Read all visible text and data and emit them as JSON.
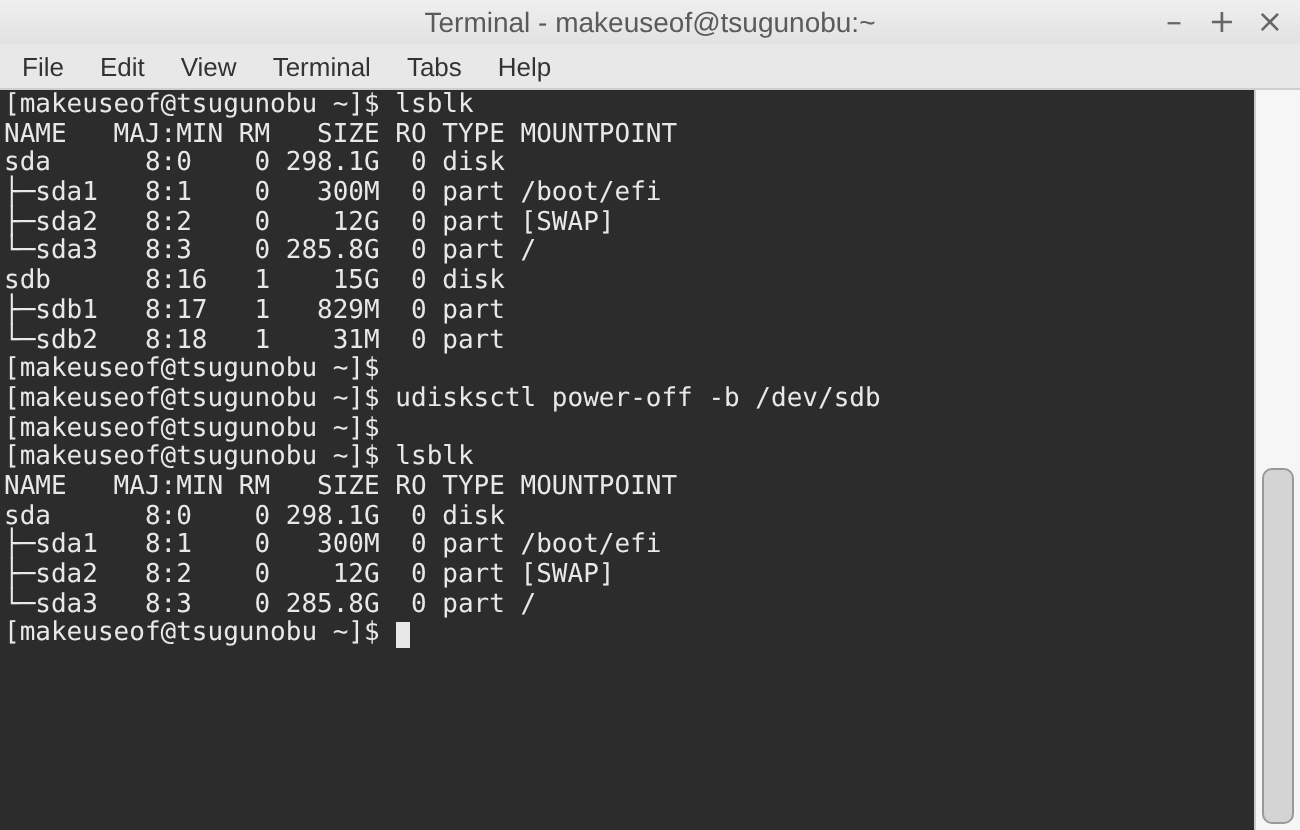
{
  "window": {
    "title": "Terminal - makeuseof@tsugunobu:~",
    "controls": [
      "–",
      "+",
      "×"
    ]
  },
  "menu": [
    "File",
    "Edit",
    "View",
    "Terminal",
    "Tabs",
    "Help"
  ],
  "terminal": {
    "lines": [
      "[makeuseof@tsugunobu ~]$ lsblk",
      "NAME   MAJ:MIN RM   SIZE RO TYPE MOUNTPOINT",
      "sda      8:0    0 298.1G  0 disk",
      "├─sda1   8:1    0   300M  0 part /boot/efi",
      "├─sda2   8:2    0    12G  0 part [SWAP]",
      "└─sda3   8:3    0 285.8G  0 part /",
      "sdb      8:16   1    15G  0 disk",
      "├─sdb1   8:17   1   829M  0 part",
      "└─sdb2   8:18   1    31M  0 part",
      "[makeuseof@tsugunobu ~]$",
      "[makeuseof@tsugunobu ~]$ udisksctl power-off -b /dev/sdb",
      "[makeuseof@tsugunobu ~]$",
      "[makeuseof@tsugunobu ~]$ lsblk",
      "NAME   MAJ:MIN RM   SIZE RO TYPE MOUNTPOINT",
      "sda      8:0    0 298.1G  0 disk",
      "├─sda1   8:1    0   300M  0 part /boot/efi",
      "├─sda2   8:2    0    12G  0 part [SWAP]",
      "└─sda3   8:3    0 285.8G  0 part /",
      "[makeuseof@tsugunobu ~]$"
    ]
  }
}
